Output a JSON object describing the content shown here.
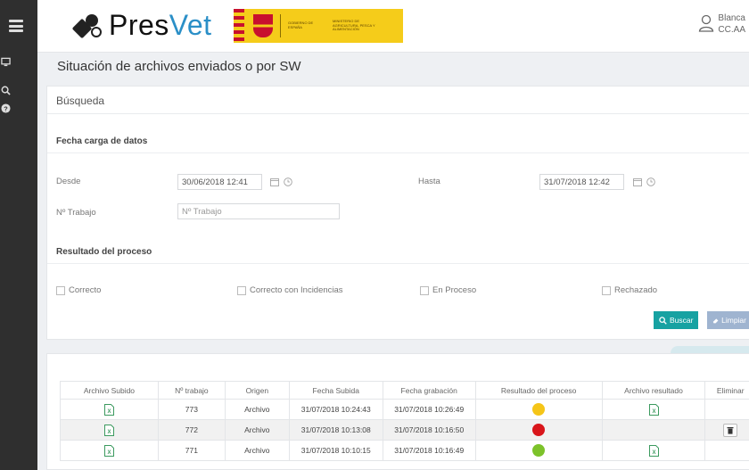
{
  "header": {
    "logo_word_a": "Pres",
    "logo_word_b": "Vet",
    "gov_text_1": "GOBIERNO DE ESPAÑA",
    "gov_text_2": "MINISTERIO DE AGRICULTURA, PESCA Y ALIMENTACIÓN",
    "user_name": "Blanca",
    "user_role": "CC.AA",
    "colors": {
      "brand_blue": "#2b8fc7",
      "banner_yellow": "#f5cc1a"
    }
  },
  "sidebar": {
    "items": [
      {
        "icon": "monitor-icon"
      },
      {
        "icon": "zoom-icon"
      },
      {
        "icon": "help-icon"
      }
    ]
  },
  "page": {
    "title": "Situación de archivos enviados o por SW"
  },
  "search": {
    "panel_title": "Búsqueda",
    "date_section": "Fecha carga de datos",
    "desde_label": "Desde",
    "desde_value": "30/06/2018 12:41",
    "hasta_label": "Hasta",
    "hasta_value": "31/07/2018 12:42",
    "trabajo_label": "Nº Trabajo",
    "trabajo_placeholder": "Nº Trabajo",
    "result_section": "Resultado del proceso",
    "checks": {
      "correcto": "Correcto",
      "incidencias": "Correcto con Incidencias",
      "proceso": "En Proceso",
      "rechazado": "Rechazado"
    },
    "buscar_label": "Buscar",
    "limpiar_label": "Limpiar"
  },
  "results": {
    "columns": [
      "Archivo Subido",
      "Nº trabajo",
      "Origen",
      "Fecha Subida",
      "Fecha grabación",
      "Resultado del proceso",
      "Archivo resultado",
      "Eliminar"
    ],
    "rows": [
      {
        "trabajo": "773",
        "origen": "Archivo",
        "fecha_subida": "31/07/2018 10:24:43",
        "fecha_grabacion": "31/07/2018 10:26:49",
        "status_color": "#f5c518",
        "has_result_file": true,
        "can_delete": false
      },
      {
        "trabajo": "772",
        "origen": "Archivo",
        "fecha_subida": "31/07/2018 10:13:08",
        "fecha_grabacion": "31/07/2018 10:16:50",
        "status_color": "#d9161b",
        "has_result_file": false,
        "can_delete": true
      },
      {
        "trabajo": "771",
        "origen": "Archivo",
        "fecha_subida": "31/07/2018 10:10:15",
        "fecha_grabacion": "31/07/2018 10:16:49",
        "status_color": "#7cc22a",
        "has_result_file": true,
        "can_delete": false
      }
    ]
  }
}
